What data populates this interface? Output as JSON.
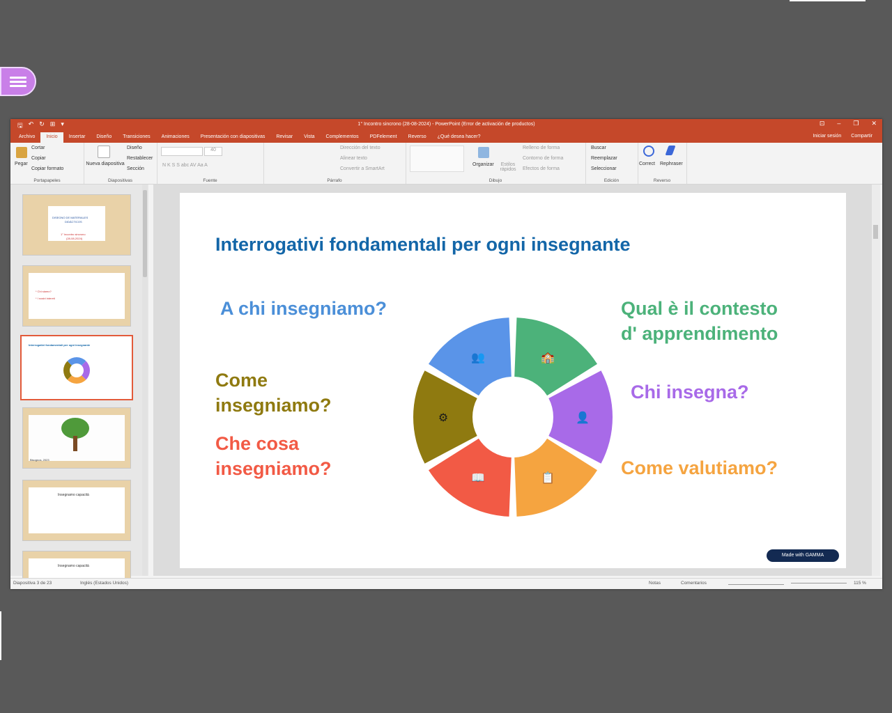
{
  "window": {
    "title": "1° Incontro sincrono (28-08-2024) - PowerPoint (Error de activación de productos)",
    "qat": [
      "🖫",
      "↶",
      "↻",
      "⊞",
      "▾"
    ],
    "controls": [
      "⊡",
      "–",
      "❐",
      "✕"
    ]
  },
  "tabs": [
    "Archivo",
    "Inicio",
    "Insertar",
    "Diseño",
    "Transiciones",
    "Animaciones",
    "Presentación con diapositivas",
    "Revisar",
    "Vista",
    "Complementos",
    "PDFelement",
    "Reverso",
    "¿Qué desea hacer?"
  ],
  "tab_right": [
    "Iniciar sesión",
    "Compartir"
  ],
  "ribbon": {
    "portapapeles": {
      "name": "Portapapeles",
      "paste": "Pegar",
      "cut": "Cortar",
      "copy": "Copiar",
      "format": "Copiar formato"
    },
    "diapositivas": {
      "name": "Diapositivas",
      "new": "Nueva diapositiva",
      "layout": "Diseño",
      "reset": "Restablecer",
      "section": "Sección"
    },
    "fuente": {
      "name": "Fuente",
      "size": "40",
      "fmt": "N  K  S  S  abc  AV  Aa  A"
    },
    "parrafo": {
      "name": "Párrafo",
      "dir": "Dirección del texto",
      "align": "Alinear texto",
      "smart": "Convertir a SmartArt"
    },
    "dibujo": {
      "name": "Dibujo",
      "arrange": "Organizar",
      "styles": "Estilos rápidos",
      "fill": "Relleno de forma",
      "outline": "Contorno de forma",
      "effects": "Efectos de forma"
    },
    "edicion": {
      "name": "Edición",
      "find": "Buscar",
      "replace": "Reemplazar",
      "select": "Seleccionar"
    },
    "reverso": {
      "name": "Reverso",
      "correct": "Correct",
      "rephrase": "Rephraser"
    }
  },
  "thumbnails": [
    {
      "num": "1",
      "lines": [
        "DISEGNO DE MATERIALES",
        "DIDÁCTICOS",
        "1° Incontro sincrono",
        "(28-08-2024)"
      ]
    },
    {
      "num": "2",
      "lines": [
        "* Chi siamo?",
        "* I nostri intereti"
      ]
    },
    {
      "num": "3",
      "lines": [
        "Interrogativi fondamentali per ogni insegnante"
      ]
    },
    {
      "num": "4",
      "lines": [
        "Bisognos, 2023"
      ]
    },
    {
      "num": "5",
      "lines": [
        "Insegnamo capacità"
      ]
    },
    {
      "num": "6",
      "lines": [
        "Insegnamo capacità"
      ]
    }
  ],
  "slide": {
    "title": "Interrogativi fondamentali per ogni insegnante",
    "q1": "A chi insegniamo?",
    "q2a": "Come",
    "q2b": "insegniamo?",
    "q3a": "Che cosa",
    "q3b": "insegniamo?",
    "q4a": "Qual è il contesto",
    "q4b": "d' apprendimento",
    "q5": "Chi insegna?",
    "q6": "Come valutiamo?",
    "badge": "Made with GAMMA"
  },
  "colors": {
    "blue": "#5a94e8",
    "green": "#4cb27a",
    "purple": "#a86ae8",
    "orange": "#f5a440",
    "red": "#f25a45",
    "olive": "#8f7a10"
  },
  "status": {
    "slide_info": "Diapositiva 3 de 23",
    "language": "Inglés (Estados Unidos)",
    "notes": "Notas",
    "comments": "Comentarios",
    "zoom": "115 %"
  }
}
